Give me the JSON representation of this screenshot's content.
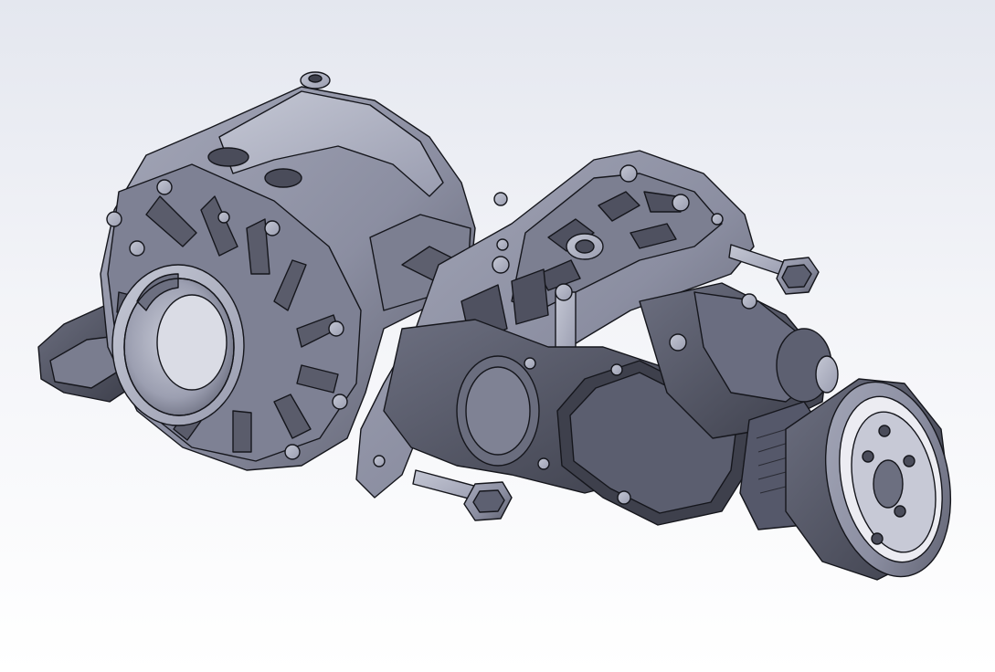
{
  "viewport": {
    "kind": "3d-model-viewport",
    "background_top": "#e4e7ef",
    "background_bottom": "#ffffff"
  },
  "model": {
    "shading": "shaded-with-edges",
    "body_color": "#8d90a3",
    "dark_color": "#4a4c5a",
    "light_color": "#b8bbca",
    "edge_color": "#15161c",
    "components": [
      {
        "icon": "differential-housing-icon"
      },
      {
        "icon": "output-flange-icon"
      },
      {
        "icon": "mounting-bracket-icon"
      },
      {
        "icon": "electric-motor-icon"
      },
      {
        "icon": "cover-plate-icon"
      },
      {
        "icon": "bolt-icon"
      }
    ]
  }
}
